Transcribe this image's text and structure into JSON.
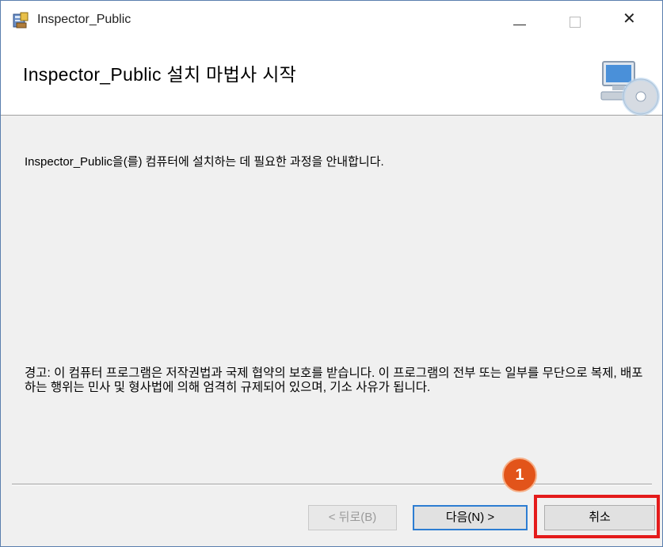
{
  "window": {
    "title": "Inspector_Public",
    "close_glyph": "✕"
  },
  "banner": {
    "title": "Inspector_Public 설치 마법사 시작",
    "icon": "computer-cd-icon"
  },
  "content": {
    "intro": "Inspector_Public을(를) 컴퓨터에 설치하는 데 필요한 과정을 안내합니다.",
    "warning": "경고: 이 컴퓨터 프로그램은 저작권법과 국제 협약의 보호를 받습니다. 이 프로그램의 전부 또는 일부를 무단으로 복제, 배포하는 행위는 민사 및 형사법에 의해 엄격히 규제되어 있으며, 기소 사유가 됩니다."
  },
  "buttons": {
    "back": "< 뒤로(B)",
    "next": "다음(N) >",
    "cancel": "취소"
  },
  "annotation": {
    "marker": "1",
    "highlight_color": "#e41b1b",
    "marker_color": "#e2541a"
  }
}
